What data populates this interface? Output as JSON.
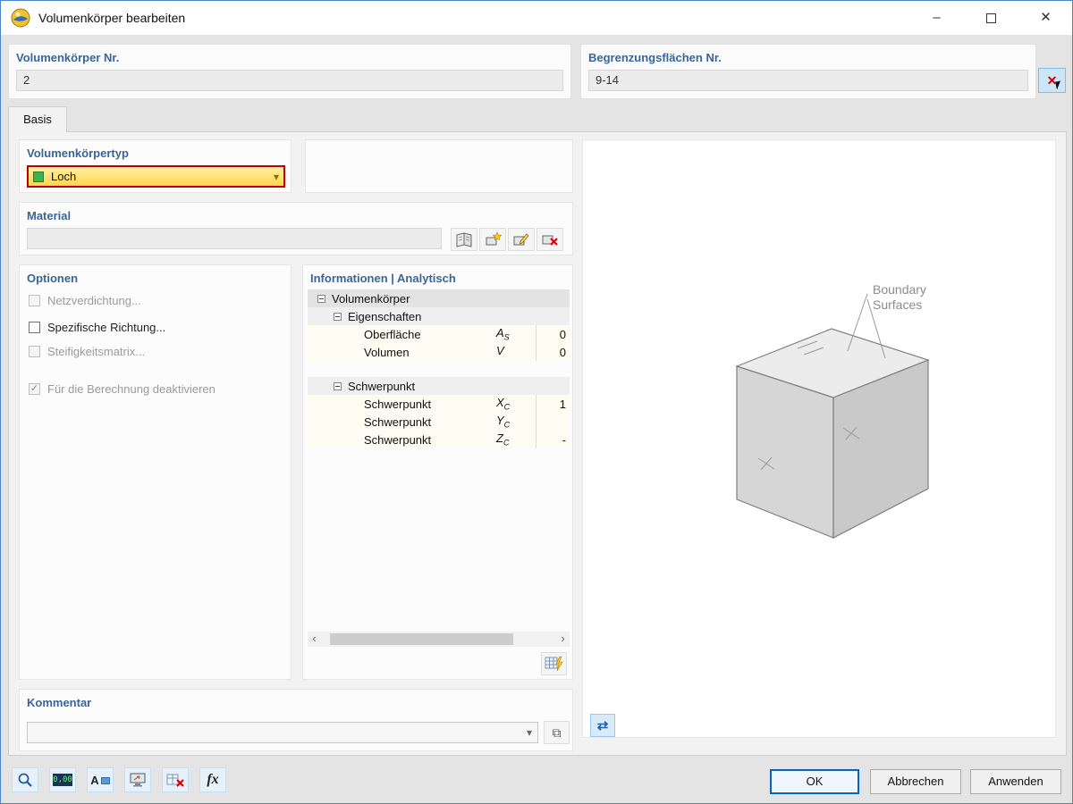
{
  "window": {
    "title": "Volumenkörper bearbeiten",
    "controls": {
      "minimize": "–",
      "close": "✕"
    }
  },
  "header": {
    "solid_no": {
      "label": "Volumenkörper Nr.",
      "value": "2"
    },
    "boundary_surfaces": {
      "label": "Begrenzungsflächen Nr.",
      "value": "9-14"
    }
  },
  "tab": {
    "label": "Basis"
  },
  "solid_type": {
    "label": "Volumenkörpertyp",
    "value": "Loch",
    "swatch_color": "#3CB44B",
    "chevron": "▾"
  },
  "material": {
    "label": "Material",
    "value": ""
  },
  "options": {
    "label": "Optionen",
    "check_glyph": "✓",
    "items": [
      {
        "label": "Netzverdichtung...",
        "checked": false,
        "disabled": true
      },
      {
        "label": "Spezifische Richtung...",
        "checked": false,
        "disabled": false
      },
      {
        "label": "Steifigkeitsmatrix...",
        "checked": false,
        "disabled": true
      },
      {
        "label": "Für die Berechnung deaktivieren",
        "checked": true,
        "disabled": true
      }
    ]
  },
  "info": {
    "title": "Informationen | Analytisch",
    "root": "Volumenkörper",
    "groups": [
      {
        "label": "Eigenschaften",
        "rows": [
          {
            "label": "Oberfläche",
            "sym": "A",
            "sub": "S",
            "value": "0"
          },
          {
            "label": "Volumen",
            "sym": "V",
            "sub": "",
            "value": "0"
          }
        ]
      },
      {
        "label": "Schwerpunkt",
        "rows": [
          {
            "label": "Schwerpunkt",
            "sym": "X",
            "sub": "C",
            "value": "1"
          },
          {
            "label": "Schwerpunkt",
            "sym": "Y",
            "sub": "C",
            "value": ""
          },
          {
            "label": "Schwerpunkt",
            "sym": "Z",
            "sub": "C",
            "value": "-"
          }
        ]
      }
    ],
    "scroll": {
      "left": "‹",
      "right": "›"
    }
  },
  "viewport": {
    "annotation": [
      "Boundary",
      "Surfaces"
    ],
    "sync_glyph": "⇄"
  },
  "comment": {
    "label": "Kommentar",
    "value": "",
    "copy_glyph": "⧉"
  },
  "toolbar": {
    "display_value": "0,00",
    "a_label": "A",
    "fx_label": "fx"
  },
  "footer": {
    "ok": "OK",
    "cancel": "Abbrechen",
    "apply": "Anwenden"
  }
}
